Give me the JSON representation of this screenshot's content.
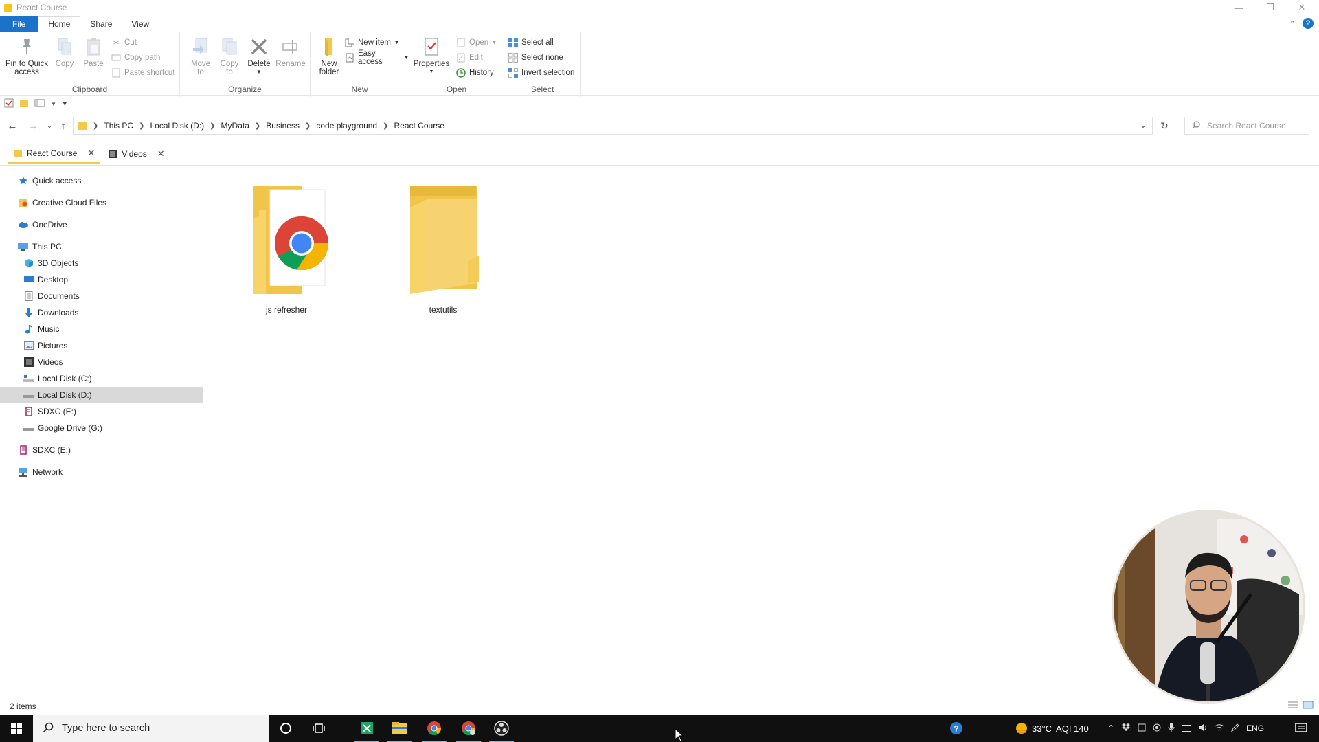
{
  "window": {
    "title": "React Course"
  },
  "ribbon": {
    "tabs": [
      "File",
      "Home",
      "Share",
      "View"
    ],
    "clipboard": {
      "label": "Clipboard",
      "pin": "Pin to Quick access",
      "copy": "Copy",
      "paste": "Paste",
      "cut": "Cut",
      "copy_path": "Copy path",
      "paste_shortcut": "Paste shortcut"
    },
    "organize": {
      "label": "Organize",
      "move_to": "Move to",
      "copy_to": "Copy to",
      "delete": "Delete",
      "rename": "Rename"
    },
    "new": {
      "label": "New",
      "new_folder": "New folder",
      "new_item": "New item",
      "easy_access": "Easy access"
    },
    "open": {
      "label": "Open",
      "properties": "Properties",
      "open": "Open",
      "edit": "Edit",
      "history": "History"
    },
    "select": {
      "label": "Select",
      "select_all": "Select all",
      "select_none": "Select none",
      "invert_selection": "Invert selection"
    }
  },
  "address": {
    "crumbs": [
      "This PC",
      "Local Disk (D:)",
      "MyData",
      "Business",
      "code playground",
      "React Course"
    ],
    "search_placeholder": "Search React Course"
  },
  "tabs": [
    {
      "label": "React Course",
      "active": true
    },
    {
      "label": "Videos",
      "active": false
    }
  ],
  "sidebar": {
    "items": [
      {
        "label": "Quick access",
        "icon": "star-icon"
      },
      {
        "label": "Creative Cloud Files",
        "icon": "creative-cloud-icon"
      },
      {
        "label": "OneDrive",
        "icon": "cloud-icon"
      },
      {
        "label": "This PC",
        "icon": "computer-icon"
      },
      {
        "label": "3D Objects",
        "icon": "cube-icon"
      },
      {
        "label": "Desktop",
        "icon": "desktop-icon"
      },
      {
        "label": "Documents",
        "icon": "document-icon"
      },
      {
        "label": "Downloads",
        "icon": "download-icon"
      },
      {
        "label": "Music",
        "icon": "music-icon"
      },
      {
        "label": "Pictures",
        "icon": "picture-icon"
      },
      {
        "label": "Videos",
        "icon": "video-icon"
      },
      {
        "label": "Local Disk (C:)",
        "icon": "drive-icon"
      },
      {
        "label": "Local Disk (D:)",
        "icon": "drive-icon",
        "selected": true
      },
      {
        "label": "SDXC (E:)",
        "icon": "sd-card-icon"
      },
      {
        "label": "Google Drive (G:)",
        "icon": "drive-icon"
      },
      {
        "label": "SDXC (E:)",
        "icon": "sd-card-icon"
      },
      {
        "label": "Network",
        "icon": "network-icon"
      }
    ]
  },
  "files": [
    {
      "name": "js refresher",
      "type": "folder-with-chrome-file"
    },
    {
      "name": "textutils",
      "type": "folder"
    }
  ],
  "status": {
    "items_count": "2 items"
  },
  "taskbar": {
    "search_placeholder": "Type here to search",
    "weather": "33°C",
    "aqi": "AQI 140",
    "language": "ENG"
  },
  "colors": {
    "accent": "#1a73c8",
    "folder": "#f2c94c",
    "taskbar": "#101010"
  }
}
